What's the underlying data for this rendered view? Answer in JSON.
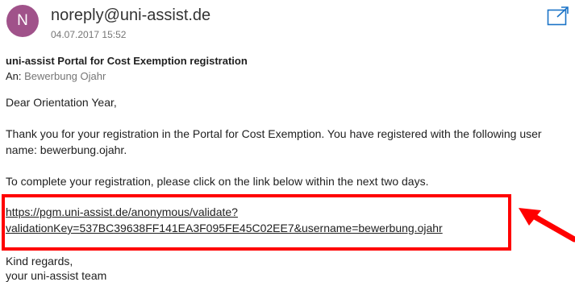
{
  "header": {
    "avatar_letter": "N",
    "avatar_color": "#a0528a",
    "sender": "noreply@uni-assist.de",
    "datetime": "04.07.2017 15:52",
    "popout_icon": "popout-icon"
  },
  "message": {
    "subject": "uni-assist Portal for Cost Exemption registration",
    "to_label": "An:",
    "to_value": "Bewerbung Ojahr",
    "greeting": "Dear Orientation Year,",
    "paragraph1_line1": "Thank you for your registration in the Portal for Cost Exemption. You have registered with the following user",
    "paragraph1_line2": "name: bewerbung.ojahr.",
    "paragraph2": "To complete your registration, please click on the link below within the next two days.",
    "link_line1": "https://pgm.uni-assist.de/anonymous/validate?",
    "link_line2": "validationKey=537BC39638FF141EA3F095FE45C02EE7&username=bewerbung.ojahr",
    "closing1": "Kind regards,",
    "closing2": "your uni-assist team"
  },
  "annotation": {
    "color": "#ff0000"
  }
}
